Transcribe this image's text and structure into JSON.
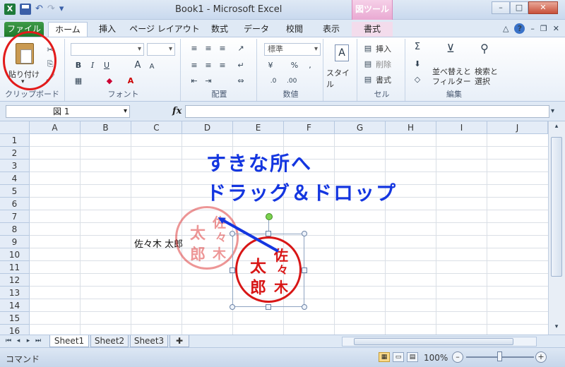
{
  "window": {
    "title": "Book1 - Microsoft Excel",
    "context_tab_group": "図ツール"
  },
  "qat": {
    "undo_glyph": "↶",
    "redo_glyph": "↷",
    "more_glyph": "▾"
  },
  "tabs": [
    {
      "label": "ファイル"
    },
    {
      "label": "ホーム"
    },
    {
      "label": "挿入"
    },
    {
      "label": "ページ レイアウト"
    },
    {
      "label": "数式"
    },
    {
      "label": "データ"
    },
    {
      "label": "校閲"
    },
    {
      "label": "表示"
    },
    {
      "label": "書式"
    }
  ],
  "ribbon": {
    "clipboard": {
      "paste_label": "貼り付け",
      "group_label": "クリップボード"
    },
    "font": {
      "bold": "B",
      "italic": "I",
      "underline": "U",
      "grow": "A",
      "shrink": "A",
      "group_label": "フォント"
    },
    "alignment": {
      "group_label": "配置"
    },
    "number": {
      "format": "標準",
      "percent": "%",
      "comma": ",",
      "group_label": "数値"
    },
    "styles": {
      "label": "スタイル"
    },
    "cells": {
      "insert": "挿入",
      "delete": "削除",
      "format": "書式",
      "group_label": "セル"
    },
    "editing": {
      "sum": "Σ",
      "sort_label": "並べ替えと",
      "sort_label2": "フィルター",
      "find_label": "検索と",
      "find_label2": "選択",
      "group_label": "編集"
    }
  },
  "formula_bar": {
    "name_box": "図 1",
    "fx": "fx",
    "formula": ""
  },
  "columns": [
    "A",
    "B",
    "C",
    "D",
    "E",
    "F",
    "G",
    "H",
    "I",
    "J"
  ],
  "rows": [
    "1",
    "2",
    "3",
    "4",
    "5",
    "6",
    "7",
    "8",
    "9",
    "10",
    "11",
    "12",
    "13",
    "14",
    "15",
    "16"
  ],
  "cells": {
    "C9": "佐々木 太郎"
  },
  "callout": {
    "line1": "すきな所へ",
    "line2": "ドラッグ＆ドロップ"
  },
  "stamp": {
    "family_1": "佐",
    "family_2": "々",
    "family_3": "木",
    "given_1": "太",
    "given_2": "郎"
  },
  "sheets": [
    "Sheet1",
    "Sheet2",
    "Sheet3"
  ],
  "status": {
    "mode": "コマンド",
    "zoom": "100%"
  },
  "colors": {
    "accent_red": "#d81616",
    "callout_blue": "#1436e0",
    "file_tab_green": "#1f7a2b"
  }
}
